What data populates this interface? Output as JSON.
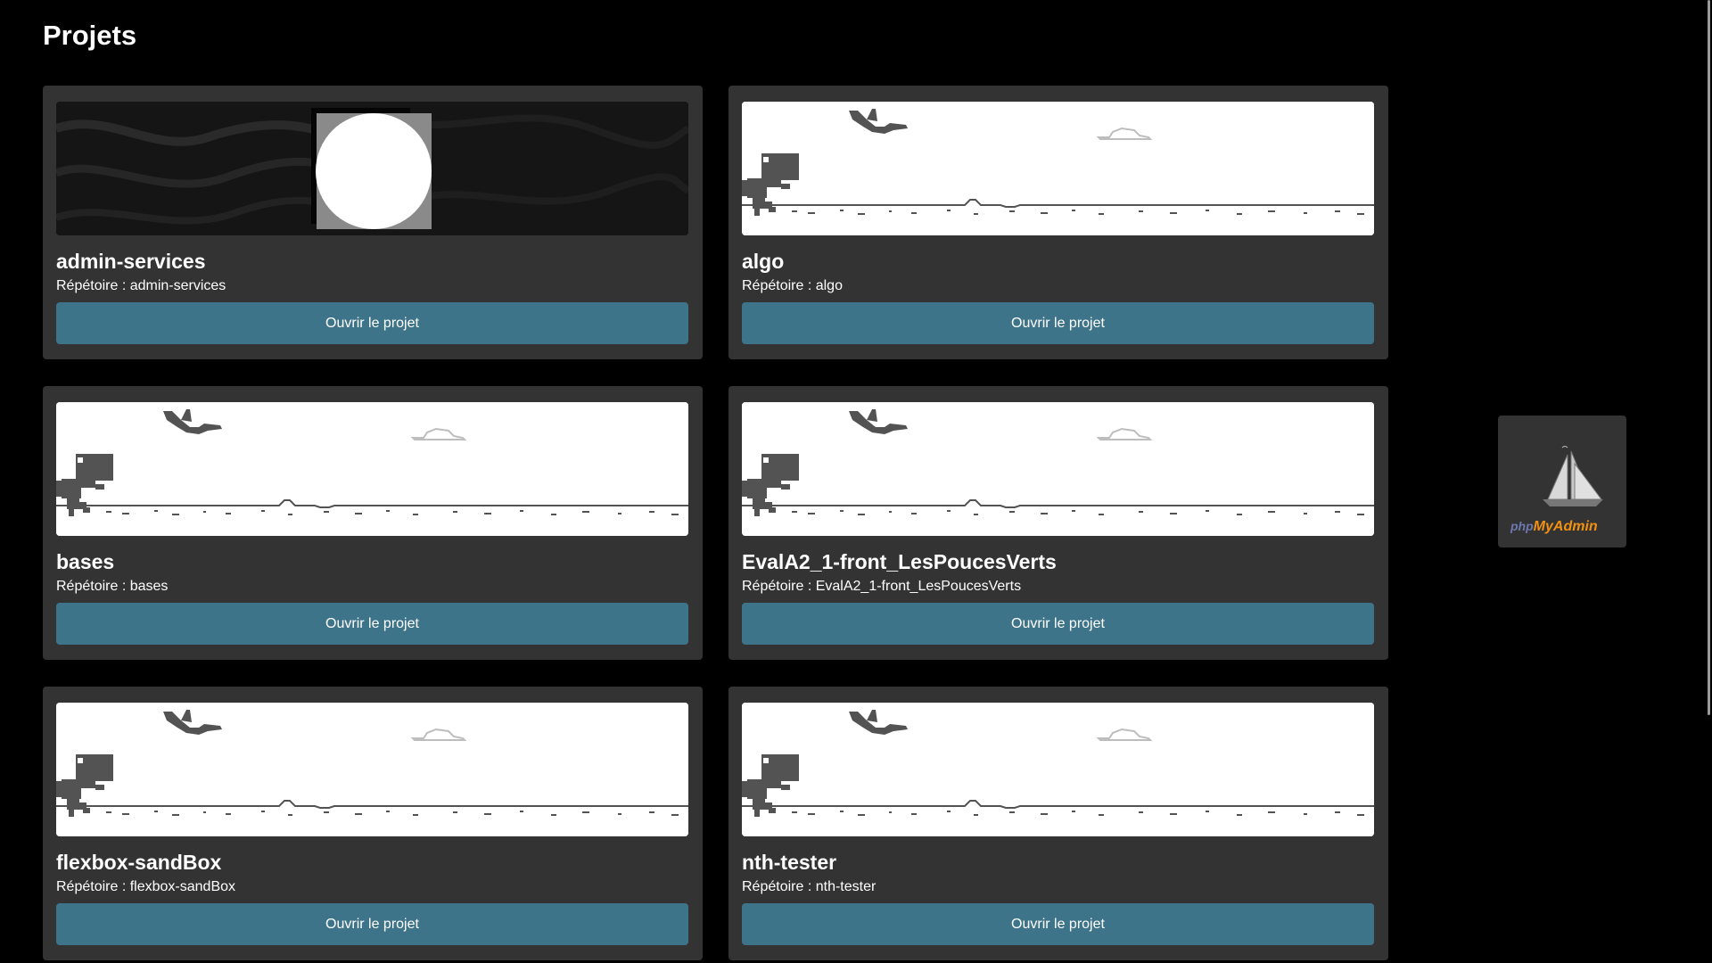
{
  "page": {
    "title": "Projets"
  },
  "projects": [
    {
      "name": "admin-services",
      "dir_label": "Répétoire :",
      "dir": "admin-services",
      "button": "Ouvrir le projet",
      "thumbnail": "custom-dark-circle"
    },
    {
      "name": "algo",
      "dir_label": "Répétoire :",
      "dir": "algo",
      "button": "Ouvrir le projet",
      "thumbnail": "dino-placeholder"
    },
    {
      "name": "bases",
      "dir_label": "Répétoire :",
      "dir": "bases",
      "button": "Ouvrir le projet",
      "thumbnail": "dino-placeholder"
    },
    {
      "name": "EvalA2_1-front_LesPoucesVerts",
      "dir_label": "Répétoire :",
      "dir": "EvalA2_1-front_LesPoucesVerts",
      "button": "Ouvrir le projet",
      "thumbnail": "dino-placeholder"
    },
    {
      "name": "flexbox-sandBox",
      "dir_label": "Répétoire :",
      "dir": "flexbox-sandBox",
      "button": "Ouvrir le projet",
      "thumbnail": "dino-placeholder"
    },
    {
      "name": "nth-tester",
      "dir_label": "Répétoire :",
      "dir": "nth-tester",
      "button": "Ouvrir le projet",
      "thumbnail": "dino-placeholder"
    }
  ],
  "side_link": {
    "logo_php": "php",
    "logo_myadmin": "MyAdmin",
    "icon": "phpmyadmin-sailboat-icon"
  },
  "colors": {
    "background": "#000000",
    "card": "#333333",
    "button": "#3e7489",
    "text": "#ffffff"
  }
}
